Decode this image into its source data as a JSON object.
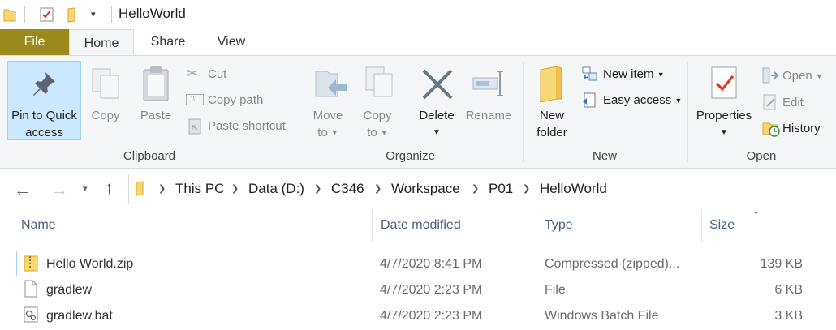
{
  "window": {
    "title": "HelloWorld"
  },
  "tabs": [
    "File",
    "Home",
    "Share",
    "View"
  ],
  "ribbon": {
    "clipboard": {
      "group_label": "Clipboard",
      "pin_line1": "Pin to Quick",
      "pin_line2": "access",
      "copy": "Copy",
      "paste": "Paste",
      "cut": "Cut",
      "copy_path": "Copy path",
      "paste_shortcut": "Paste shortcut"
    },
    "organize": {
      "group_label": "Organize",
      "move_line1": "Move",
      "move_line2": "to",
      "copy_line1": "Copy",
      "copy_line2": "to",
      "delete": "Delete",
      "rename": "Rename"
    },
    "new": {
      "group_label": "New",
      "folder_line1": "New",
      "folder_line2": "folder",
      "new_item": "New item",
      "easy_access": "Easy access"
    },
    "open": {
      "group_label": "Open",
      "properties": "Properties",
      "open": "Open",
      "edit": "Edit",
      "history": "History"
    }
  },
  "breadcrumb": [
    "This PC",
    "Data (D:)",
    "C346",
    "Workspace",
    "P01",
    "HelloWorld"
  ],
  "columns": {
    "name": "Name",
    "date": "Date modified",
    "type": "Type",
    "size": "Size"
  },
  "files": [
    {
      "name": "Hello World.zip",
      "date": "4/7/2020 8:41 PM",
      "type": "Compressed (zipped)...",
      "size": "139 KB",
      "icon": "zip-folder-icon",
      "selected": true
    },
    {
      "name": "gradlew",
      "date": "4/7/2020 2:23 PM",
      "type": "File",
      "size": "6 KB",
      "icon": "file-icon",
      "selected": false
    },
    {
      "name": "gradlew.bat",
      "date": "4/7/2020 2:23 PM",
      "type": "Windows Batch File",
      "size": "3 KB",
      "icon": "batch-file-icon",
      "selected": false
    }
  ]
}
